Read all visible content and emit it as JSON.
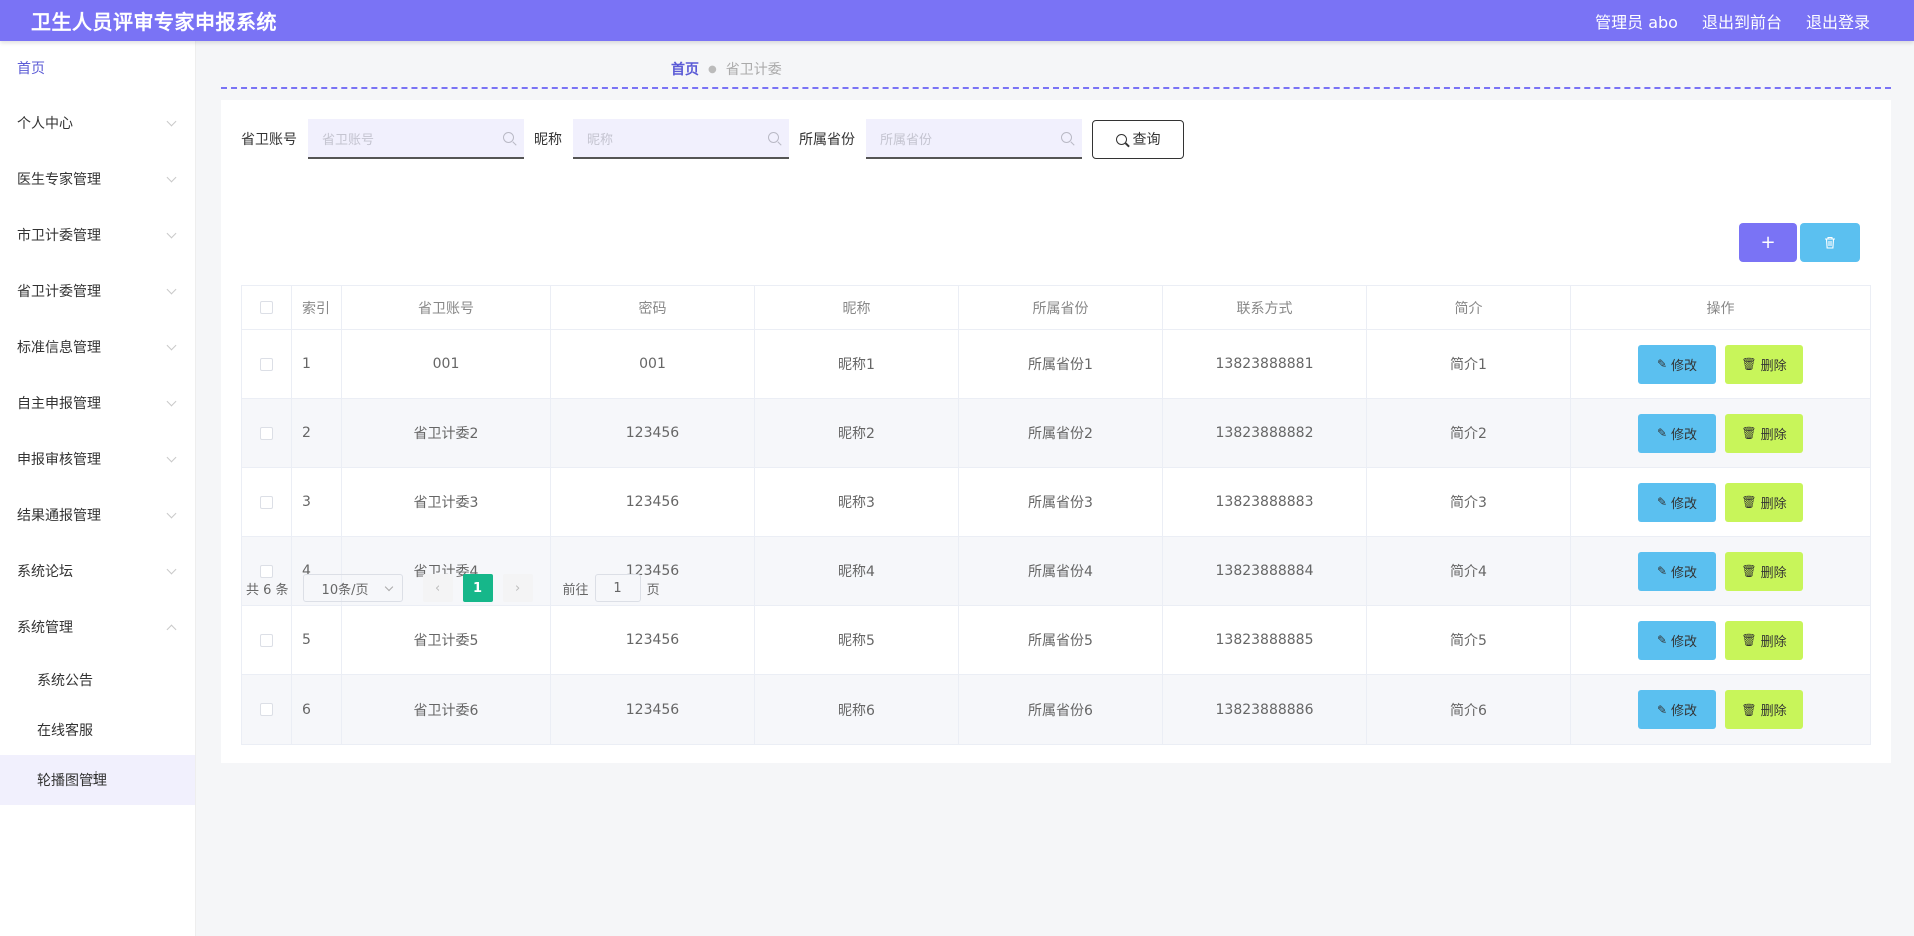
{
  "header": {
    "title": "卫生人员评审专家申报系统",
    "user": "管理员 abo",
    "to_front": "退出到前台",
    "logout": "退出登录"
  },
  "sidebar": {
    "home": "首页",
    "items": [
      {
        "label": "个人中心"
      },
      {
        "label": "医生专家管理"
      },
      {
        "label": "市卫计委管理"
      },
      {
        "label": "省卫计委管理"
      },
      {
        "label": "标准信息管理"
      },
      {
        "label": "自主申报管理"
      },
      {
        "label": "申报审核管理"
      },
      {
        "label": "结果通报管理"
      },
      {
        "label": "系统论坛"
      },
      {
        "label": "系统管理"
      }
    ],
    "sub_items": [
      {
        "label": "系统公告"
      },
      {
        "label": "在线客服"
      },
      {
        "label": "轮播图管理"
      }
    ]
  },
  "breadcrumb": {
    "home": "首页",
    "current": "省卫计委"
  },
  "search": {
    "account_label": "省卫账号",
    "account_placeholder": "省卫账号",
    "nickname_label": "昵称",
    "nickname_placeholder": "昵称",
    "province_label": "所属省份",
    "province_placeholder": "所属省份",
    "query_label": "查询"
  },
  "toolbar": {
    "add_label": "+",
    "delete_icon": "trash-icon"
  },
  "table": {
    "headers": [
      "索引",
      "省卫账号",
      "密码",
      "昵称",
      "所属省份",
      "联系方式",
      "简介",
      "操作"
    ],
    "rows": [
      {
        "idx": "1",
        "account": "001",
        "password": "001",
        "nickname": "昵称1",
        "province": "所属省份1",
        "phone": "13823888881",
        "intro": "简介1"
      },
      {
        "idx": "2",
        "account": "省卫计委2",
        "password": "123456",
        "nickname": "昵称2",
        "province": "所属省份2",
        "phone": "13823888882",
        "intro": "简介2"
      },
      {
        "idx": "3",
        "account": "省卫计委3",
        "password": "123456",
        "nickname": "昵称3",
        "province": "所属省份3",
        "phone": "13823888883",
        "intro": "简介3"
      },
      {
        "idx": "4",
        "account": "省卫计委4",
        "password": "123456",
        "nickname": "昵称4",
        "province": "所属省份4",
        "phone": "13823888884",
        "intro": "简介4"
      },
      {
        "idx": "5",
        "account": "省卫计委5",
        "password": "123456",
        "nickname": "昵称5",
        "province": "所属省份5",
        "phone": "13823888885",
        "intro": "简介5"
      },
      {
        "idx": "6",
        "account": "省卫计委6",
        "password": "123456",
        "nickname": "昵称6",
        "province": "所属省份6",
        "phone": "13823888886",
        "intro": "简介6"
      }
    ],
    "edit_label": "修改",
    "delete_label": "删除"
  },
  "pagination": {
    "total": "共 6 条",
    "page_size": "10条/页",
    "current_page": "1",
    "goto_prefix": "前往",
    "goto_value": "1",
    "goto_suffix": "页",
    "prev": "‹",
    "next": "›"
  },
  "colors": {
    "primary": "#7a73f5",
    "edit": "#5bc0f0",
    "delete": "#c8f55a",
    "page_active": "#16b78a"
  }
}
